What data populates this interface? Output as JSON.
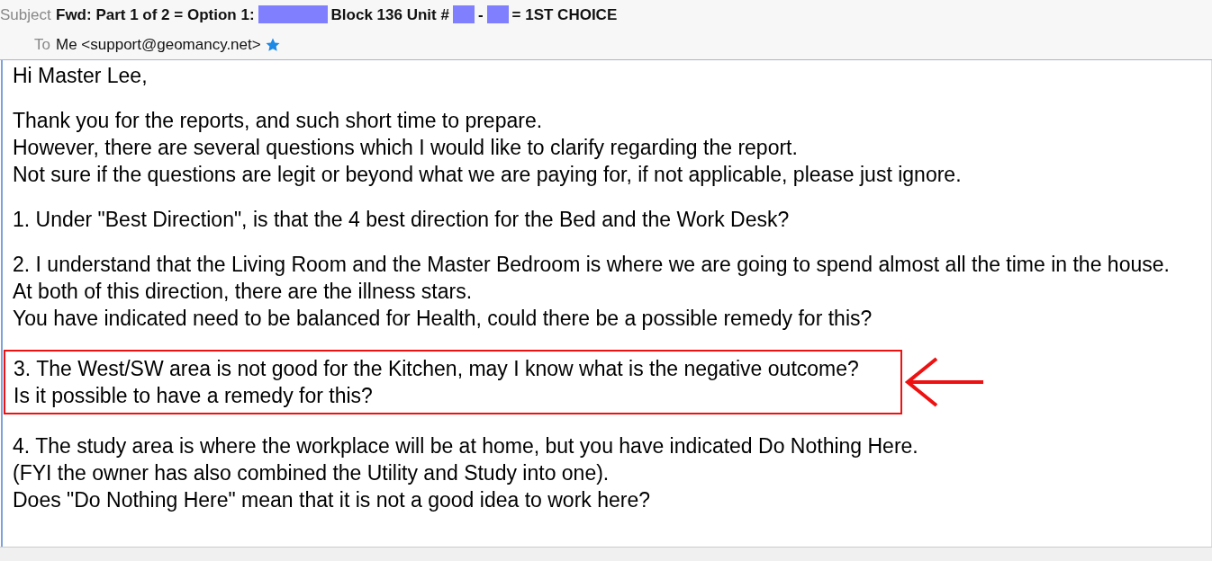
{
  "header": {
    "subject_label": "Subject",
    "subject": [
      {
        "kind": "text",
        "text": "Fwd: Part 1 of 2 = Option 1:"
      },
      {
        "kind": "redaction"
      },
      {
        "kind": "text",
        "text": "Block 136 Unit #"
      },
      {
        "kind": "redaction"
      },
      {
        "kind": "text",
        "text": "-"
      },
      {
        "kind": "redaction"
      },
      {
        "kind": "text",
        "text": "= 1ST CHOICE"
      }
    ],
    "to_label": "To",
    "to": "Me <support@geomancy.net>",
    "starred": true
  },
  "body": {
    "greeting": "Hi Master Lee,",
    "paragraphs": [
      {
        "highlighted": false,
        "lines": [
          "Thank you for the reports, and such short time to prepare.",
          "However, there are several questions which I would like to clarify regarding the report.",
          "Not sure if the questions are legit or beyond what we are paying for, if not applicable, please just ignore."
        ]
      },
      {
        "highlighted": false,
        "lines": [
          "1. Under \"Best Direction\", is that the 4 best direction for the Bed and the Work Desk?"
        ]
      },
      {
        "highlighted": false,
        "lines": [
          "2. I understand that the Living Room and the Master Bedroom is where we are going to spend almost all the time in the house.",
          "At both of this direction, there are the illness stars.",
          "You have indicated need to be balanced for Health, could there be a possible remedy for this?"
        ]
      },
      {
        "highlighted": true,
        "lines": [
          "3. The West/SW area is not good for the Kitchen, may I know what is the negative outcome?",
          "Is it possible to have a remedy for this?"
        ]
      },
      {
        "highlighted": false,
        "lines": [
          "4. The study area is where the workplace will be at home, but you have indicated Do Nothing Here.",
          "(FYI the owner has also combined the Utility and Study into one).",
          "Does \"Do Nothing Here\" mean that it is not a good idea to work here?"
        ]
      }
    ]
  }
}
